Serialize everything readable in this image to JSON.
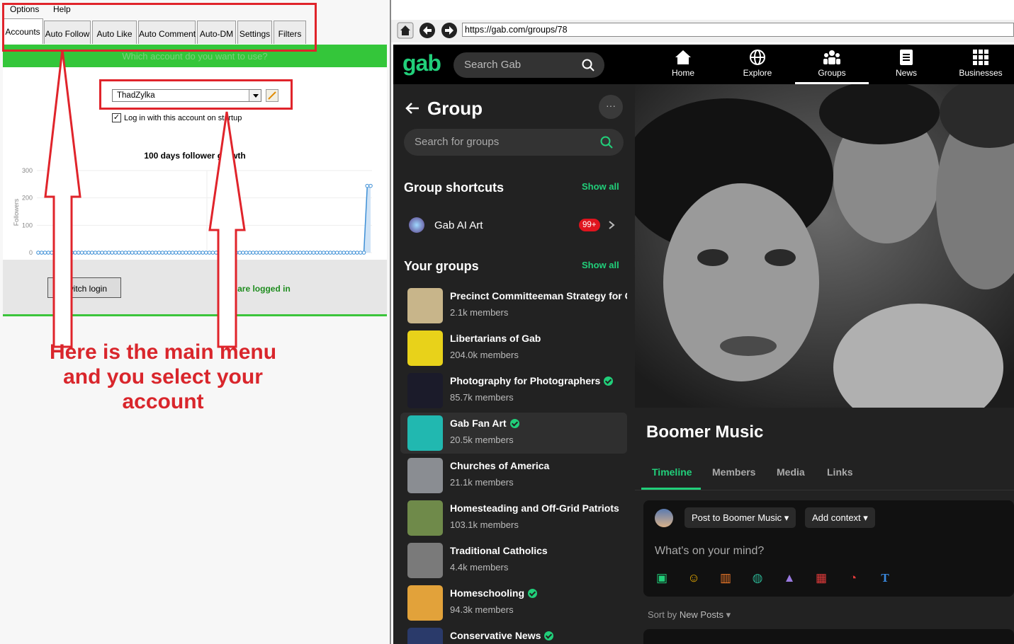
{
  "menu": {
    "options": "Options",
    "help": "Help"
  },
  "tabs": [
    "Accounts",
    "Auto Follow",
    "Auto Like",
    "Auto Comment",
    "Auto-DM",
    "Settings",
    "Filters"
  ],
  "account": {
    "prompt": "Which account do you want to use?",
    "selected": "ThadZylka",
    "startup_label": "Log in with this account on startup",
    "startup_checked": true
  },
  "chart_data": {
    "type": "line",
    "title": "100 days follower growth",
    "ylabel": "Followers",
    "xlabel": "",
    "ylim": [
      0,
      300
    ],
    "yticks": [
      0,
      100,
      200,
      300
    ],
    "series": [
      {
        "values_description_count": 100,
        "values": [
          0,
          0,
          0,
          0,
          0,
          0,
          0,
          0,
          0,
          0,
          0,
          0,
          0,
          0,
          0,
          0,
          0,
          0,
          0,
          0,
          0,
          0,
          0,
          0,
          0,
          0,
          0,
          0,
          0,
          0,
          0,
          0,
          0,
          0,
          0,
          0,
          0,
          0,
          0,
          0,
          0,
          0,
          0,
          0,
          0,
          0,
          0,
          0,
          0,
          0,
          0,
          0,
          0,
          0,
          0,
          0,
          0,
          0,
          0,
          0,
          0,
          0,
          0,
          0,
          0,
          0,
          0,
          0,
          0,
          0,
          0,
          0,
          0,
          0,
          0,
          0,
          0,
          0,
          0,
          0,
          0,
          0,
          0,
          0,
          0,
          0,
          0,
          0,
          0,
          0,
          0,
          0,
          0,
          0,
          0,
          0,
          0,
          0,
          244,
          244
        ]
      }
    ],
    "color": "#3d8fd6",
    "grid": true
  },
  "login": {
    "switch_label": "Switch login",
    "status": "You are logged in"
  },
  "annotation": {
    "lines": [
      "Here is the main menu",
      "and you select your",
      "account"
    ]
  },
  "browser": {
    "url": "https://gab.com/groups/78"
  },
  "gab": {
    "logo": "gab",
    "search_placeholder": "Search Gab",
    "nav": [
      "Home",
      "Explore",
      "Groups",
      "News",
      "Businesses"
    ],
    "active_nav": "Groups",
    "group_heading": "Group",
    "group_search_placeholder": "Search for groups",
    "shortcuts_heading": "Group shortcuts",
    "show_all": "Show all",
    "shortcut": {
      "name": "Gab AI Art",
      "badge": "99+"
    },
    "your_groups_heading": "Your groups",
    "groups": [
      {
        "name": "Precinct Committeeman Strategy for Cc",
        "members": "2.1k members",
        "verified": false,
        "color": "#c8b58a"
      },
      {
        "name": "Libertarians of Gab",
        "members": "204.0k members",
        "verified": false,
        "color": "#e8d21a"
      },
      {
        "name": "Photography for Photographers",
        "members": "85.7k members",
        "verified": true,
        "color": "#1b1b2a"
      },
      {
        "name": "Gab Fan Art",
        "members": "20.5k members",
        "verified": true,
        "color": "#21b8b0"
      },
      {
        "name": "Churches of America",
        "members": "21.1k members",
        "verified": false,
        "color": "#8a8d92"
      },
      {
        "name": "Homesteading and Off-Grid Patriots",
        "members": "103.1k members",
        "verified": false,
        "color": "#6f8a4a"
      },
      {
        "name": "Traditional Catholics",
        "members": "4.4k members",
        "verified": false,
        "color": "#7a7a7a"
      },
      {
        "name": "Homeschooling",
        "members": "94.3k members",
        "verified": true,
        "color": "#e2a23a"
      },
      {
        "name": "Conservative News",
        "members": "",
        "verified": true,
        "color": "#2a3a6a"
      }
    ],
    "main": {
      "group_name": "Boomer Music",
      "tabs": [
        "Timeline",
        "Members",
        "Media",
        "Links"
      ],
      "post_to": "Post to Boomer Music",
      "add_context": "Add context",
      "placeholder": "What's on your mind?",
      "sort_prefix": "Sort by",
      "sort_value": "New Posts"
    }
  }
}
